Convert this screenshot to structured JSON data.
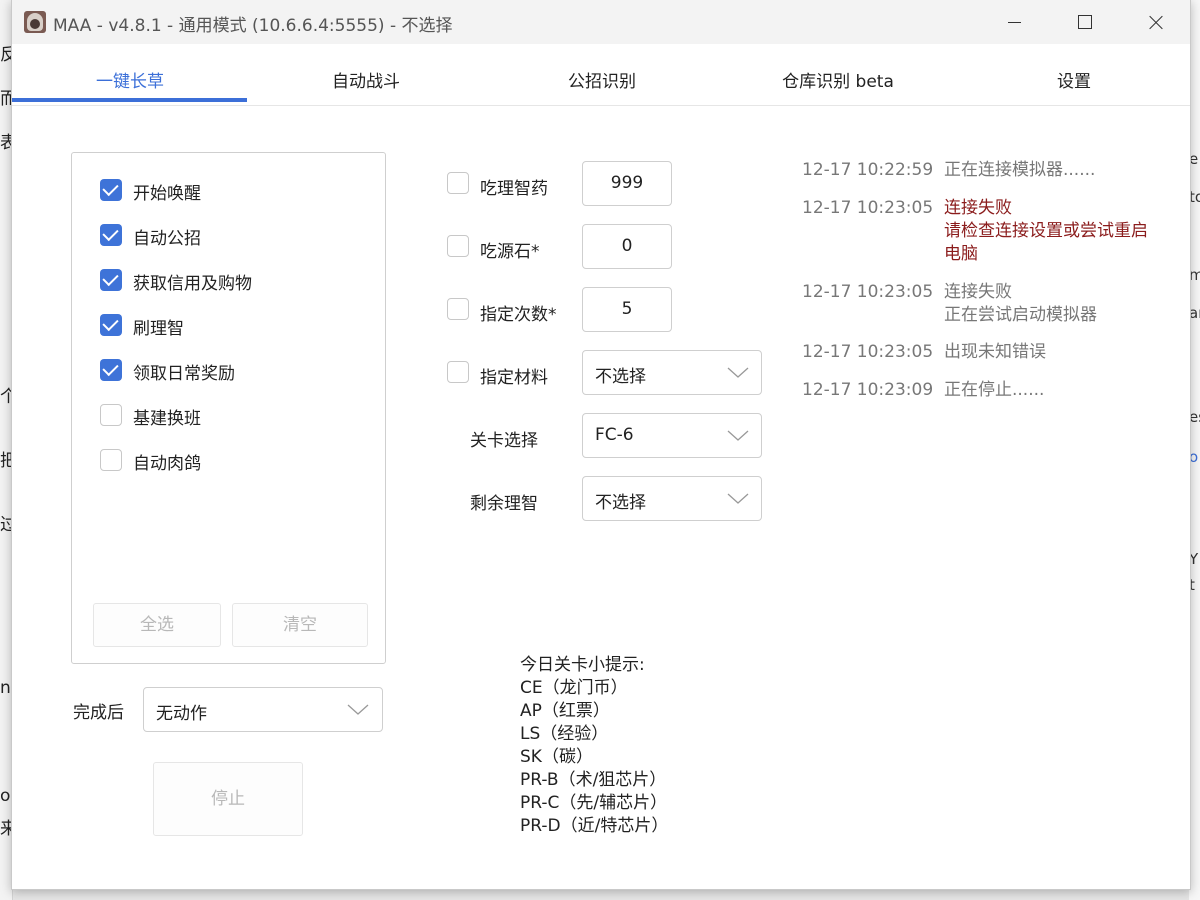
{
  "background_fragments": {
    "left": [
      "反",
      "而",
      "表",
      "个",
      "把",
      "过",
      "n",
      "o",
      "来"
    ],
    "right": [
      "e",
      "to",
      "m",
      "ar",
      "es",
      "o",
      "Y",
      "t"
    ]
  },
  "window": {
    "title": "MAA - v4.8.1 - 通用模式 (10.6.6.4:5555) - 不选择"
  },
  "tabs": [
    "一键长草",
    "自动战斗",
    "公招识别",
    "仓库识别 beta",
    "设置"
  ],
  "active_tab": 0,
  "tasks": [
    {
      "label": "开始唤醒",
      "checked": true
    },
    {
      "label": "自动公招",
      "checked": true
    },
    {
      "label": "获取信用及购物",
      "checked": true
    },
    {
      "label": "刷理智",
      "checked": true
    },
    {
      "label": "领取日常奖励",
      "checked": true
    },
    {
      "label": "基建换班",
      "checked": false
    },
    {
      "label": "自动肉鸽",
      "checked": false
    }
  ],
  "task_buttons": {
    "select_all": "全选",
    "clear": "清空"
  },
  "after_completion": {
    "label": "完成后",
    "value": "无动作"
  },
  "stop_button": "停止",
  "fight_settings": {
    "medicine": {
      "label": "吃理智药",
      "checked": false,
      "value": "999"
    },
    "stone": {
      "label": "吃源石*",
      "checked": false,
      "value": "0"
    },
    "times": {
      "label": "指定次数*",
      "checked": false,
      "value": "5"
    },
    "material": {
      "label": "指定材料",
      "checked": false,
      "value": "不选择"
    },
    "stage": {
      "label": "关卡选择",
      "value": "FC-6"
    },
    "remaining": {
      "label": "剩余理智",
      "value": "不选择"
    }
  },
  "tips": {
    "title": "今日关卡小提示:",
    "lines": [
      "CE（龙门币）",
      "AP（红票）",
      "LS（经验）",
      "SK（碳）",
      "PR-B（术/狙芯片）",
      "PR-C（先/辅芯片）",
      "PR-D（近/特芯片）"
    ]
  },
  "logs": [
    {
      "time": "12-17  10:22:59",
      "msg": "正在连接模拟器......",
      "color": "#777777"
    },
    {
      "time": "12-17  10:23:05",
      "msg": "连接失败\n请检查连接设置或尝试重启电脑",
      "color": "#8b1c1c"
    },
    {
      "time": "12-17  10:23:05",
      "msg": "连接失败\n正在尝试启动模拟器",
      "color": "#777777"
    },
    {
      "time": "12-17  10:23:05",
      "msg": "出现未知错误",
      "color": "#777777"
    },
    {
      "time": "12-17  10:23:09",
      "msg": "正在停止......",
      "color": "#777777"
    }
  ],
  "colors": {
    "accent": "#3c6fd8",
    "error": "#8b1c1c",
    "muted": "#777777"
  }
}
